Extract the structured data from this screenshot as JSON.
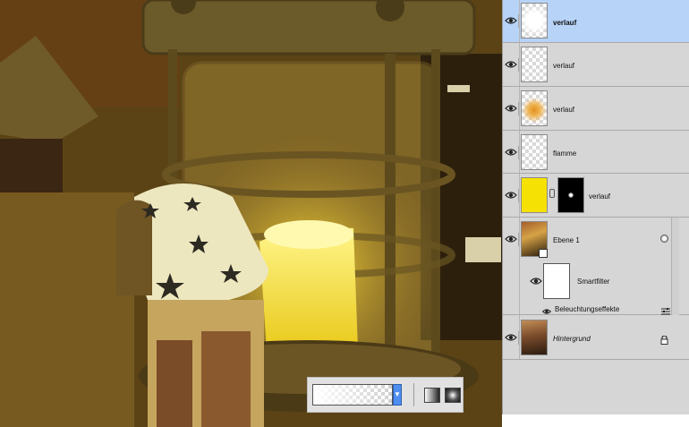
{
  "canvas": {
    "description_colors": {
      "glow": "#f6e438",
      "tint": "#8a6a1e",
      "dark": "#3a2810"
    }
  },
  "layers_panel": {
    "layers": [
      {
        "name": "verlauf",
        "selected": true,
        "bold": true,
        "thumb": "white-glow"
      },
      {
        "name": "verlauf",
        "selected": false,
        "thumb": "transparent"
      },
      {
        "name": "verlauf",
        "selected": false,
        "thumb": "orange-glow"
      },
      {
        "name": "flamme",
        "selected": false,
        "thumb": "transparent"
      },
      {
        "name": "verlauf",
        "selected": false,
        "thumb": "yellow-fill",
        "has_mask": true
      },
      {
        "name": "Ebene 1",
        "selected": false,
        "thumb": "photo",
        "smart_object": true
      },
      {
        "name": "Smartfilter",
        "selected": false,
        "thumb": "white-mask"
      },
      {
        "name": "Beleuchtungseffekte",
        "selected": false,
        "filter_effect": true
      },
      {
        "name": "Hintergrund",
        "selected": false,
        "italic": true,
        "thumb": "photo",
        "locked": true
      }
    ]
  },
  "gradient_toolbar": {
    "gradient": "white-to-transparent",
    "dropdown_icon": "triangle-down-icon",
    "types": [
      "linear-gradient-icon",
      "radial-gradient-icon"
    ]
  }
}
